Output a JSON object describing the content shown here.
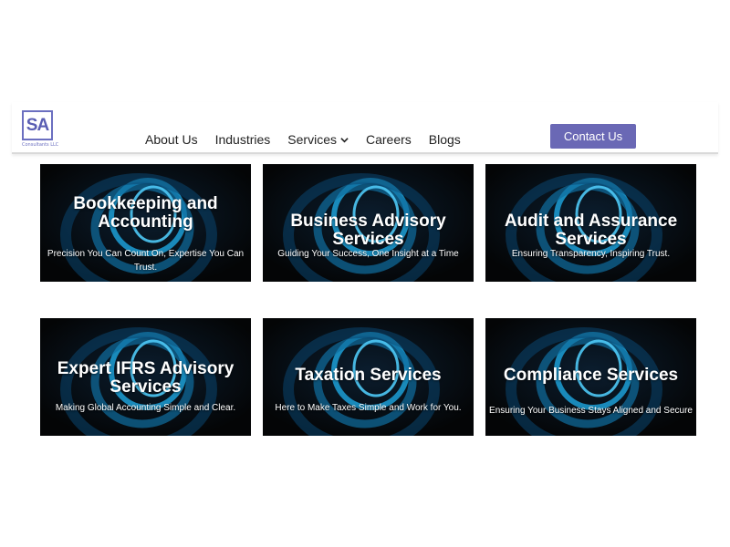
{
  "brand": {
    "logo_text": "SA",
    "logo_sub": "Consultants LLC",
    "accent_color": "#6a68b5"
  },
  "nav": {
    "items": [
      "About Us",
      "Industries",
      "Services",
      "Careers",
      "Blogs"
    ],
    "services_dropdown_icon": "chevron-down-icon"
  },
  "contact_button": {
    "label": "Contact Us"
  },
  "services": [
    {
      "title": "Bookkeeping and Accounting",
      "subtitle": "Precision You Can Count On, Expertise You Can Trust."
    },
    {
      "title": "Business Advisory Services",
      "subtitle": "Guiding Your Success, One Insight at a Time"
    },
    {
      "title": "Audit and Assurance Services",
      "subtitle": "Ensuring Transparency, Inspiring Trust."
    },
    {
      "title": "Expert IFRS Advisory Services",
      "subtitle": "Making Global Accounting Simple and Clear."
    },
    {
      "title": "Taxation Services",
      "subtitle": "Here to Make Taxes Simple and Work for You."
    },
    {
      "title": "Compliance Services",
      "subtitle": "Ensuring Your Business Stays Aligned and Secure"
    }
  ]
}
